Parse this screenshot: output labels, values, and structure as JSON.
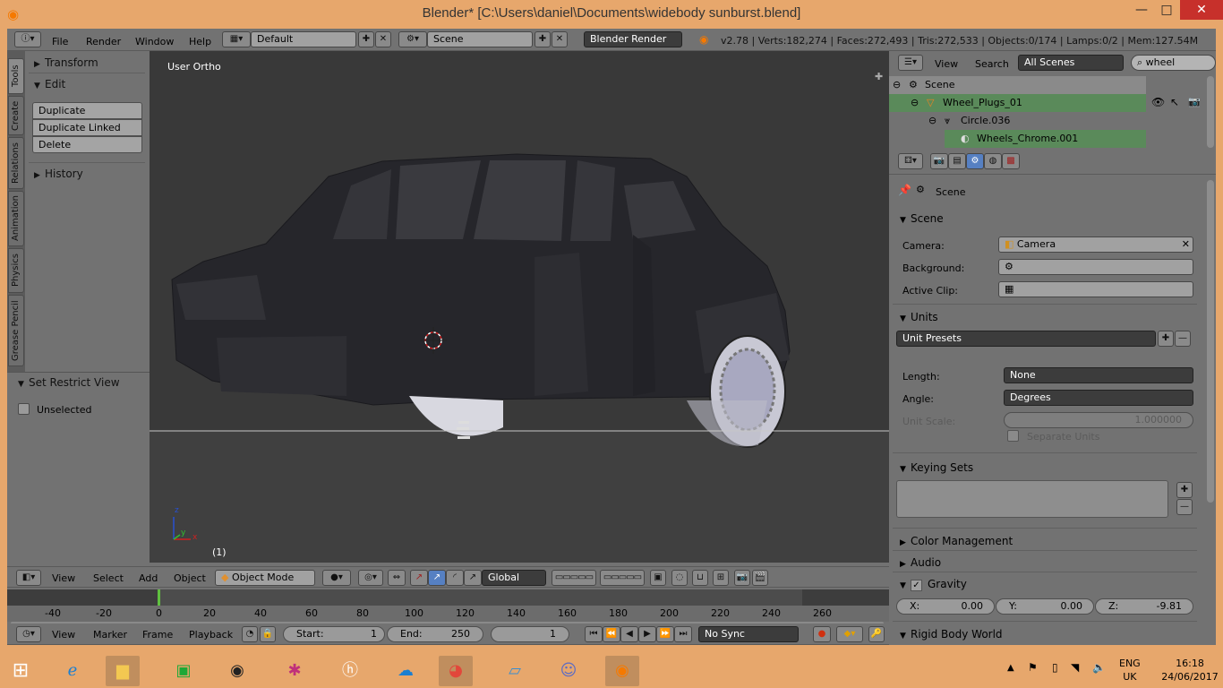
{
  "window": {
    "title": "Blender* [C:\\Users\\daniel\\Documents\\widebody sunburst.blend]",
    "minimize": "—",
    "maximize": "□",
    "close": "✕"
  },
  "top_menu": {
    "items": [
      "File",
      "Render",
      "Window",
      "Help"
    ],
    "screen_layout": "Default",
    "scene": "Scene",
    "render_engine": "Blender Render",
    "stats": "v2.78 | Verts:182,274 | Faces:272,493 | Tris:272,533 | Objects:0/174 | Lamps:0/2 | Mem:127.54M"
  },
  "tool_shelf": {
    "tabs": [
      "Tools",
      "Create",
      "Relations",
      "Animation",
      "Physics",
      "Grease Pencil"
    ],
    "panels": {
      "transform": "Transform",
      "edit": "Edit",
      "history": "History"
    },
    "edit_buttons": [
      "Duplicate",
      "Duplicate Linked",
      "Delete"
    ],
    "restrict_panel": "Set Restrict View",
    "unselected": "Unselected"
  },
  "viewport": {
    "view_label": "User Ortho",
    "frame_label": "(1)",
    "axis_x": "x",
    "axis_y": "y",
    "axis_z": "z"
  },
  "view3d_header": {
    "menus": [
      "View",
      "Select",
      "Add",
      "Object"
    ],
    "mode": "Object Mode",
    "orientation": "Global"
  },
  "timeline": {
    "ruler": [
      "-40",
      "-20",
      "0",
      "20",
      "40",
      "60",
      "80",
      "100",
      "120",
      "140",
      "160",
      "180",
      "200",
      "220",
      "240",
      "260"
    ],
    "menus": [
      "View",
      "Marker",
      "Frame",
      "Playback"
    ],
    "start_label": "Start:",
    "start_value": "1",
    "end_label": "End:",
    "end_value": "250",
    "current_frame": "1",
    "sync": "No Sync"
  },
  "outliner": {
    "menus": [
      "View",
      "Search"
    ],
    "filter": "All Scenes",
    "search_value": "wheel",
    "rows": [
      {
        "label": "Scene"
      },
      {
        "label": "Wheel_Plugs_01"
      },
      {
        "label": "Circle.036"
      },
      {
        "label": "Wheels_Chrome.001"
      }
    ]
  },
  "properties": {
    "context": "Scene",
    "scene_panel": "Scene",
    "camera_label": "Camera:",
    "camera_value": "Camera",
    "background_label": "Background:",
    "active_clip_label": "Active Clip:",
    "units_panel": "Units",
    "unit_presets": "Unit Presets",
    "length_label": "Length:",
    "length_value": "None",
    "angle_label": "Angle:",
    "angle_value": "Degrees",
    "unit_scale_label": "Unit Scale:",
    "unit_scale_value": "1.000000",
    "separate_units": "Separate Units",
    "keying_sets": "Keying Sets",
    "color_management": "Color Management",
    "audio": "Audio",
    "gravity": "Gravity",
    "gx_label": "X:",
    "gx": "0.00",
    "gy_label": "Y:",
    "gy": "0.00",
    "gz_label": "Z:",
    "gz": "-9.81",
    "rigid_body": "Rigid Body World"
  },
  "taskbar": {
    "lang": "ENG",
    "region": "UK",
    "time": "16:18",
    "date": "24/06/2017"
  },
  "colors": {
    "accent_green": "#5a8a5a",
    "timeline_marker": "#60c040",
    "record": "#d03010"
  }
}
